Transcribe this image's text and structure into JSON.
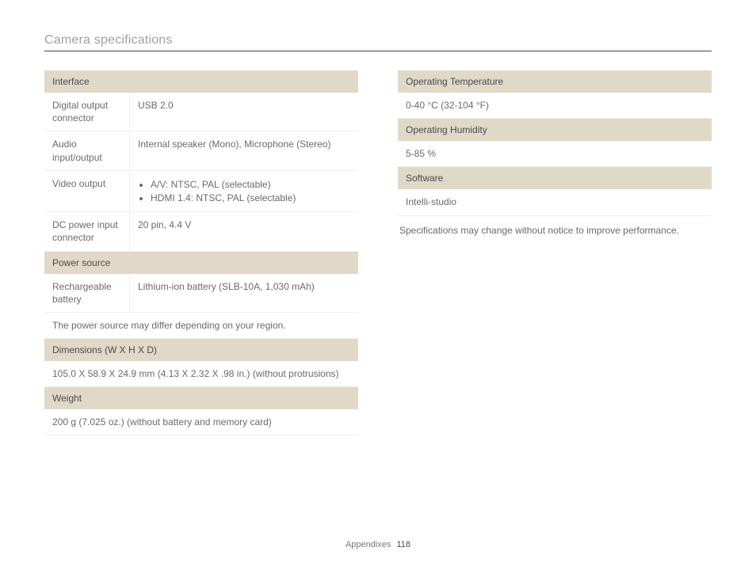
{
  "page_title": "Camera specifications",
  "left": {
    "interface": {
      "header": "Interface",
      "rows": [
        {
          "label": "Digital output connector",
          "value": "USB 2.0"
        },
        {
          "label": "Audio input/output",
          "value": "Internal speaker (Mono), Microphone (Stereo)"
        },
        {
          "label": "Video output",
          "bullets": [
            "A/V: NTSC, PAL (selectable)",
            "HDMI 1.4: NTSC, PAL (selectable)"
          ]
        },
        {
          "label": "DC power input connector",
          "value": "20 pin, 4.4 V"
        }
      ]
    },
    "power_source": {
      "header": "Power source",
      "rows": [
        {
          "label": "Rechargeable battery",
          "value": "Lithium-ion battery (SLB-10A, 1,030 mAh)"
        }
      ],
      "note": "The power source may differ depending on your region."
    },
    "dimensions": {
      "header": "Dimensions (W X H X D)",
      "value": "105.0 X 58.9 X 24.9 mm (4.13 X 2.32 X .98 in.) (without protrusions)"
    },
    "weight": {
      "header": "Weight",
      "value": "200 g (7.025 oz.) (without battery and memory card)"
    }
  },
  "right": {
    "op_temp": {
      "header": "Operating Temperature",
      "value": "0-40 °C (32-104 °F)"
    },
    "op_humidity": {
      "header": "Operating Humidity",
      "value": "5-85 %"
    },
    "software": {
      "header": "Software",
      "value": "Intelli-studio"
    },
    "disclaimer": "Specifications may change without notice to improve performance."
  },
  "footer": {
    "section": "Appendixes",
    "page": "118"
  }
}
